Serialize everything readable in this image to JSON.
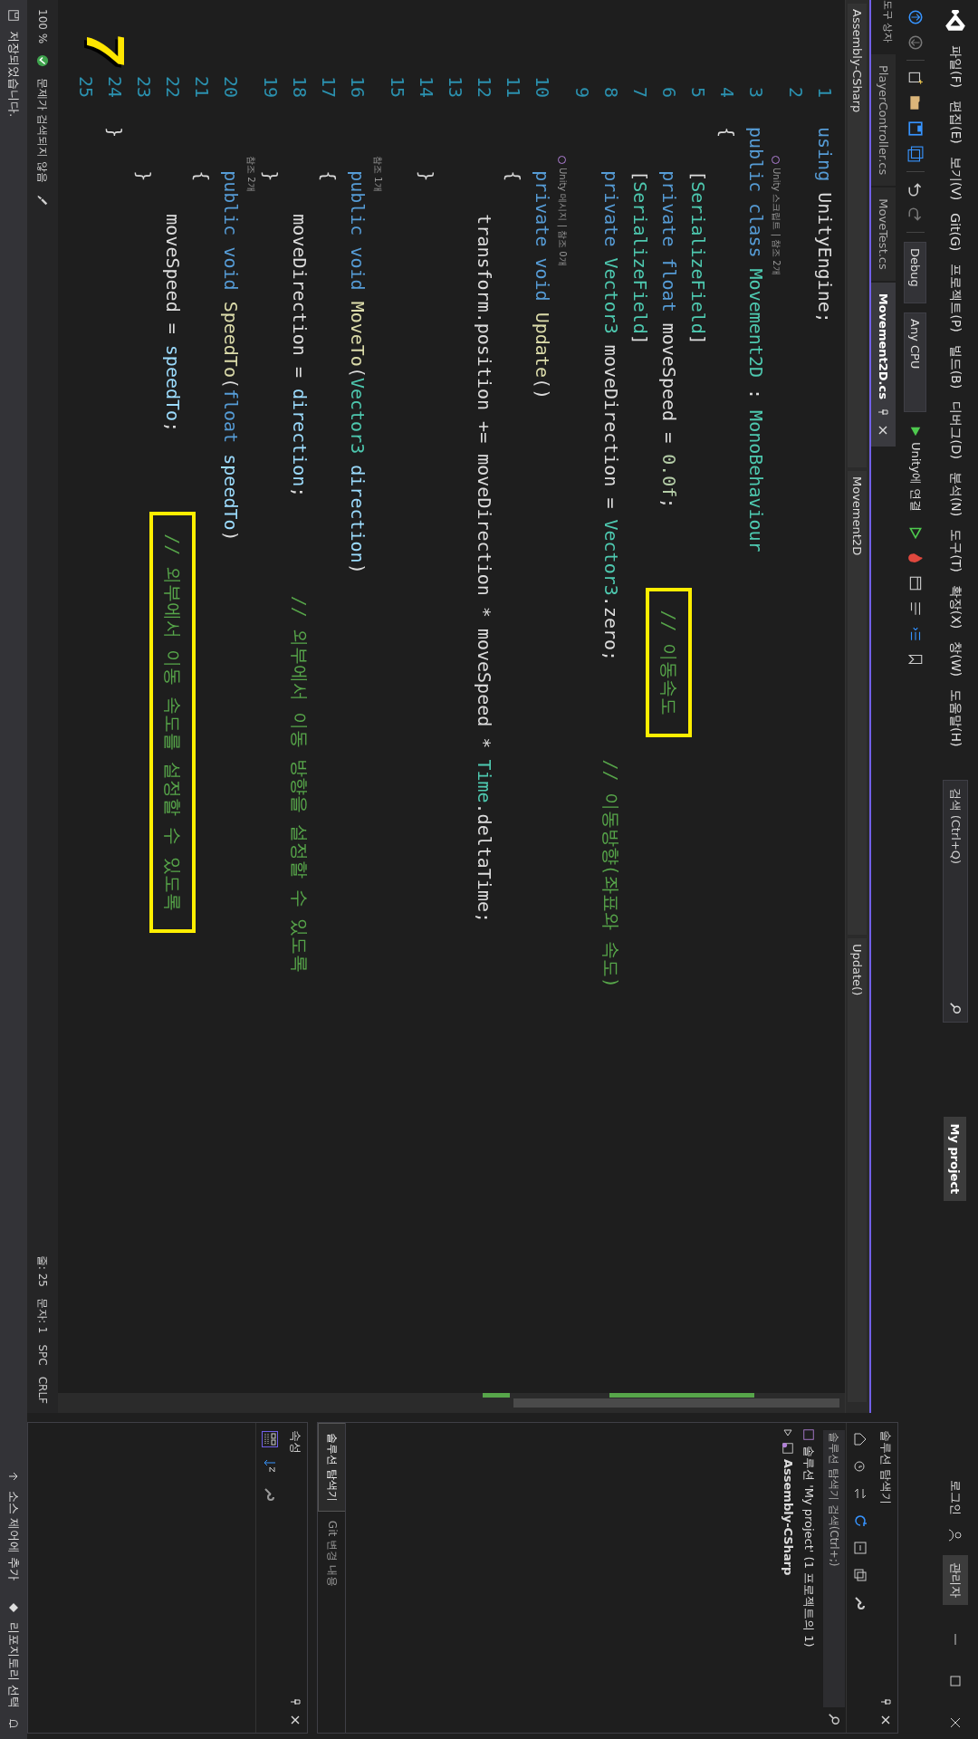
{
  "menu": {
    "items": [
      "파일(F)",
      "편집(E)",
      "보기(V)",
      "Git(G)",
      "프로젝트(P)",
      "빌드(B)",
      "디버그(D)",
      "분석(N)",
      "도구(T)",
      "확장(X)",
      "창(W)",
      "도움말(H)"
    ],
    "search": "검색 (Ctrl+Q)",
    "project": "My project",
    "login": "로그인",
    "admin": "관리자"
  },
  "toolbar": {
    "configuration": "Debug",
    "platform": "Any CPU",
    "run": "Unity에 연결"
  },
  "toolbox_tab": "도구 상자",
  "tabs": [
    {
      "label": "PlayerController.cs",
      "selected": false
    },
    {
      "label": "MoveTest.cs",
      "selected": false
    },
    {
      "label": "Movement2D.cs",
      "selected": true
    }
  ],
  "navbar": {
    "project": "Assembly-CSharp",
    "type": "Movement2D",
    "member": "Update()"
  },
  "step_number": "7",
  "code": [
    {
      "number": "1",
      "tokens": [
        {
          "text": "using",
          "kind": "keyword"
        },
        {
          "text": " UnityEngine;",
          "kind": "plain"
        }
      ]
    },
    {
      "number": "2"
    },
    {
      "number": "3",
      "lens": {
        "text": "Unity 스크립트 | 참조 2개",
        "kind": "unity"
      },
      "tokens": [
        {
          "text": "public class ",
          "kind": "keyword"
        },
        {
          "text": "Movement2D",
          "kind": "type"
        },
        {
          "text": " : ",
          "kind": "plain"
        },
        {
          "text": "MonoBehaviour",
          "kind": "type"
        }
      ]
    },
    {
      "number": "4",
      "tokens": [
        {
          "text": "{",
          "kind": "plain"
        }
      ]
    },
    {
      "number": "5",
      "tokens": [
        {
          "text": "    [",
          "kind": "plain"
        },
        {
          "text": "SerializeField",
          "kind": "type"
        },
        {
          "text": "]",
          "kind": "plain"
        }
      ]
    },
    {
      "number": "6",
      "tokens": [
        {
          "text": "    private float ",
          "kind": "keyword"
        },
        {
          "text": "moveSpeed = ",
          "kind": "plain"
        },
        {
          "text": "0.0f",
          "kind": "number"
        },
        {
          "text": ";",
          "kind": "plain"
        },
        {
          "text": "// 이동속도",
          "kind": "boxed-comment"
        }
      ]
    },
    {
      "number": "7",
      "tokens": [
        {
          "text": "    [",
          "kind": "plain"
        },
        {
          "text": "SerializeField",
          "kind": "type"
        },
        {
          "text": "]",
          "kind": "plain"
        }
      ]
    },
    {
      "number": "8",
      "tokens": [
        {
          "text": "    private ",
          "kind": "keyword"
        },
        {
          "text": "Vector3",
          "kind": "type"
        },
        {
          "text": " moveDirection = ",
          "kind": "plain"
        },
        {
          "text": "Vector3",
          "kind": "type"
        },
        {
          "text": ".zero;         ",
          "kind": "plain"
        },
        {
          "text": "// 이동방향(좌표와 속도)",
          "kind": "comment"
        }
      ]
    },
    {
      "number": "9"
    },
    {
      "number": "10",
      "lens": {
        "text": "Unity 메시지 | 참조 0개",
        "kind": "unity"
      },
      "tokens": [
        {
          "text": "    private void ",
          "kind": "keyword"
        },
        {
          "text": "Update",
          "kind": "method"
        },
        {
          "text": "()",
          "kind": "plain"
        }
      ]
    },
    {
      "number": "11",
      "tokens": [
        {
          "text": "    {",
          "kind": "plain"
        }
      ]
    },
    {
      "number": "12",
      "tokens": [
        {
          "text": "        transform.position += moveDirection * moveSpeed * ",
          "kind": "plain"
        },
        {
          "text": "Time",
          "kind": "type"
        },
        {
          "text": ".deltaTime;",
          "kind": "plain"
        }
      ]
    },
    {
      "number": "13"
    },
    {
      "number": "14",
      "tokens": [
        {
          "text": "    }",
          "kind": "plain"
        }
      ]
    },
    {
      "number": "15"
    },
    {
      "number": "16",
      "lens": {
        "text": "참조 1개",
        "kind": "plain"
      },
      "tokens": [
        {
          "text": "    public void ",
          "kind": "keyword"
        },
        {
          "text": "MoveTo",
          "kind": "method"
        },
        {
          "text": "(",
          "kind": "plain"
        },
        {
          "text": "Vector3",
          "kind": "type"
        },
        {
          "text": " direction",
          "kind": "param"
        },
        {
          "text": ")",
          "kind": "plain"
        }
      ]
    },
    {
      "number": "17",
      "tokens": [
        {
          "text": "    {",
          "kind": "plain"
        }
      ]
    },
    {
      "number": "18",
      "tokens": [
        {
          "text": "        moveDirection = ",
          "kind": "plain"
        },
        {
          "text": "direction",
          "kind": "param"
        },
        {
          "text": ";         ",
          "kind": "plain"
        },
        {
          "text": "// 외부에서 이동 방향을 설정할 수 있도록",
          "kind": "comment"
        }
      ]
    },
    {
      "number": "19",
      "tokens": [
        {
          "text": "    }",
          "kind": "plain"
        }
      ]
    },
    {
      "number": "20",
      "lens": {
        "text": "참조 2개",
        "kind": "plain"
      },
      "tokens": [
        {
          "text": "    public void ",
          "kind": "keyword"
        },
        {
          "text": "SpeedTo",
          "kind": "method"
        },
        {
          "text": "(",
          "kind": "plain"
        },
        {
          "text": "float",
          "kind": "keyword"
        },
        {
          "text": " speedTo",
          "kind": "param"
        },
        {
          "text": ")",
          "kind": "plain"
        }
      ]
    },
    {
      "number": "21",
      "tokens": [
        {
          "text": "    {",
          "kind": "plain"
        }
      ]
    },
    {
      "number": "22",
      "tokens": [
        {
          "text": "        moveSpeed = ",
          "kind": "plain"
        },
        {
          "text": "speedTo",
          "kind": "param"
        },
        {
          "text": ";",
          "kind": "plain"
        },
        {
          "text": "// 외부에서 이동 속도를 설정할 수 있도록",
          "kind": "boxed-comment"
        }
      ]
    },
    {
      "number": "23",
      "tokens": [
        {
          "text": "    }",
          "kind": "plain"
        }
      ]
    },
    {
      "number": "24",
      "tokens": [
        {
          "text": "}",
          "kind": "plain"
        }
      ]
    },
    {
      "number": "25"
    }
  ],
  "editor_status": {
    "zoom": "100 %",
    "issues": "문제가 검색되지 않음",
    "line": "줄: 25",
    "column": "문자: 1",
    "spacing": "SPC",
    "line_ending": "CRLF"
  },
  "solution_explorer": {
    "title": "솔루션 탐색기",
    "search": {
      "placeholder": "솔루션 탐색기 검색(Ctrl+;)"
    },
    "tree": [
      {
        "label": "솔루션 'My project' (1 프로젝트의 1)",
        "children": [
          {
            "label": "Assembly-CSharp",
            "expanded": false
          }
        ]
      }
    ]
  },
  "panel_tabs": [
    {
      "label": "솔루션 탐색기",
      "selected": true
    },
    {
      "label": "Git 변경 내용",
      "selected": false
    }
  ],
  "properties": {
    "title": "속성"
  },
  "status_bar": {
    "message": "저장되었습니다.",
    "source_control": "소스 제어에 추가",
    "repository": "리포지토리 선택"
  }
}
